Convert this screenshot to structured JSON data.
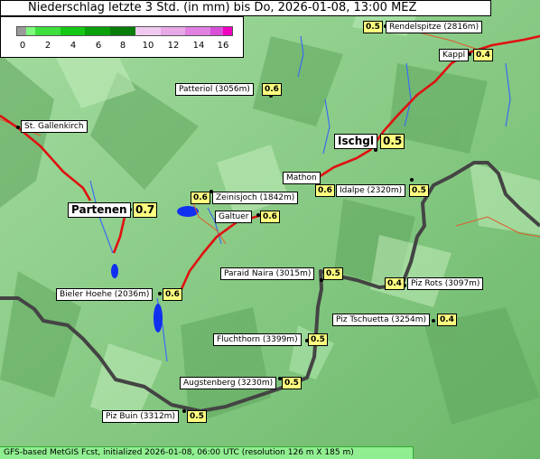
{
  "title": "Niederschlag letzte 3 Std. (in mm) bis Do, 2026-01-08, 13:00 MEZ",
  "legend": {
    "ticks": [
      "0",
      "2",
      "4",
      "6",
      "8",
      "10",
      "12",
      "14",
      "16"
    ],
    "colors": [
      "#9a9a9a",
      "#7cfc7c",
      "#3ee03e",
      "#14c814",
      "#0aa00a",
      "#087c08",
      "#f0c8f0",
      "#e8a8e8",
      "#e080e0",
      "#d850d8",
      "#f000c0"
    ]
  },
  "places": [
    {
      "id": "rendelspitze",
      "name": "Rendelspitze (2816m)",
      "value": "0.5"
    },
    {
      "id": "kappl",
      "name": "Kappl",
      "value": "0.4"
    },
    {
      "id": "patteriol",
      "name": "Patteriol (3056m)",
      "value": "0.6"
    },
    {
      "id": "st-gallenkirch",
      "name": "St. Gallenkirch",
      "value": ""
    },
    {
      "id": "ischgl",
      "name": "Ischgl",
      "value": "0.5"
    },
    {
      "id": "mathon",
      "name": "Mathon",
      "value": "0.6"
    },
    {
      "id": "idalpe",
      "name": "Idalpe (2320m)",
      "value": "0.5"
    },
    {
      "id": "zeinisjoch",
      "name": "Zeinisjoch (1842m)",
      "value": "0.6"
    },
    {
      "id": "partenen",
      "name": "Partenen",
      "value": "0.7"
    },
    {
      "id": "galtuer",
      "name": "Galtuer",
      "value": "0.6"
    },
    {
      "id": "paraid-naira",
      "name": "Paraid Naira (3015m)",
      "value": "0.5"
    },
    {
      "id": "piz-rots",
      "name": "Piz Rots (3097m)",
      "value": "0.4"
    },
    {
      "id": "bieler-hoehe",
      "name": "Bieler Hoehe (2036m)",
      "value": "0.6"
    },
    {
      "id": "piz-tschuetta",
      "name": "Piz Tschuetta (3254m)",
      "value": "0.4"
    },
    {
      "id": "fluchthorn",
      "name": "Fluchthorn (3399m)",
      "value": "0.5"
    },
    {
      "id": "augstenberg",
      "name": "Augstenberg (3230m)",
      "value": "0.5"
    },
    {
      "id": "piz-buin",
      "name": "Piz Buin (3312m)",
      "value": "0.5"
    }
  ],
  "footer": "GFS-based MetGIS Fcst, initialized 2026-01-08, 06:00 UTC  (resolution 126 m X 185 m)"
}
